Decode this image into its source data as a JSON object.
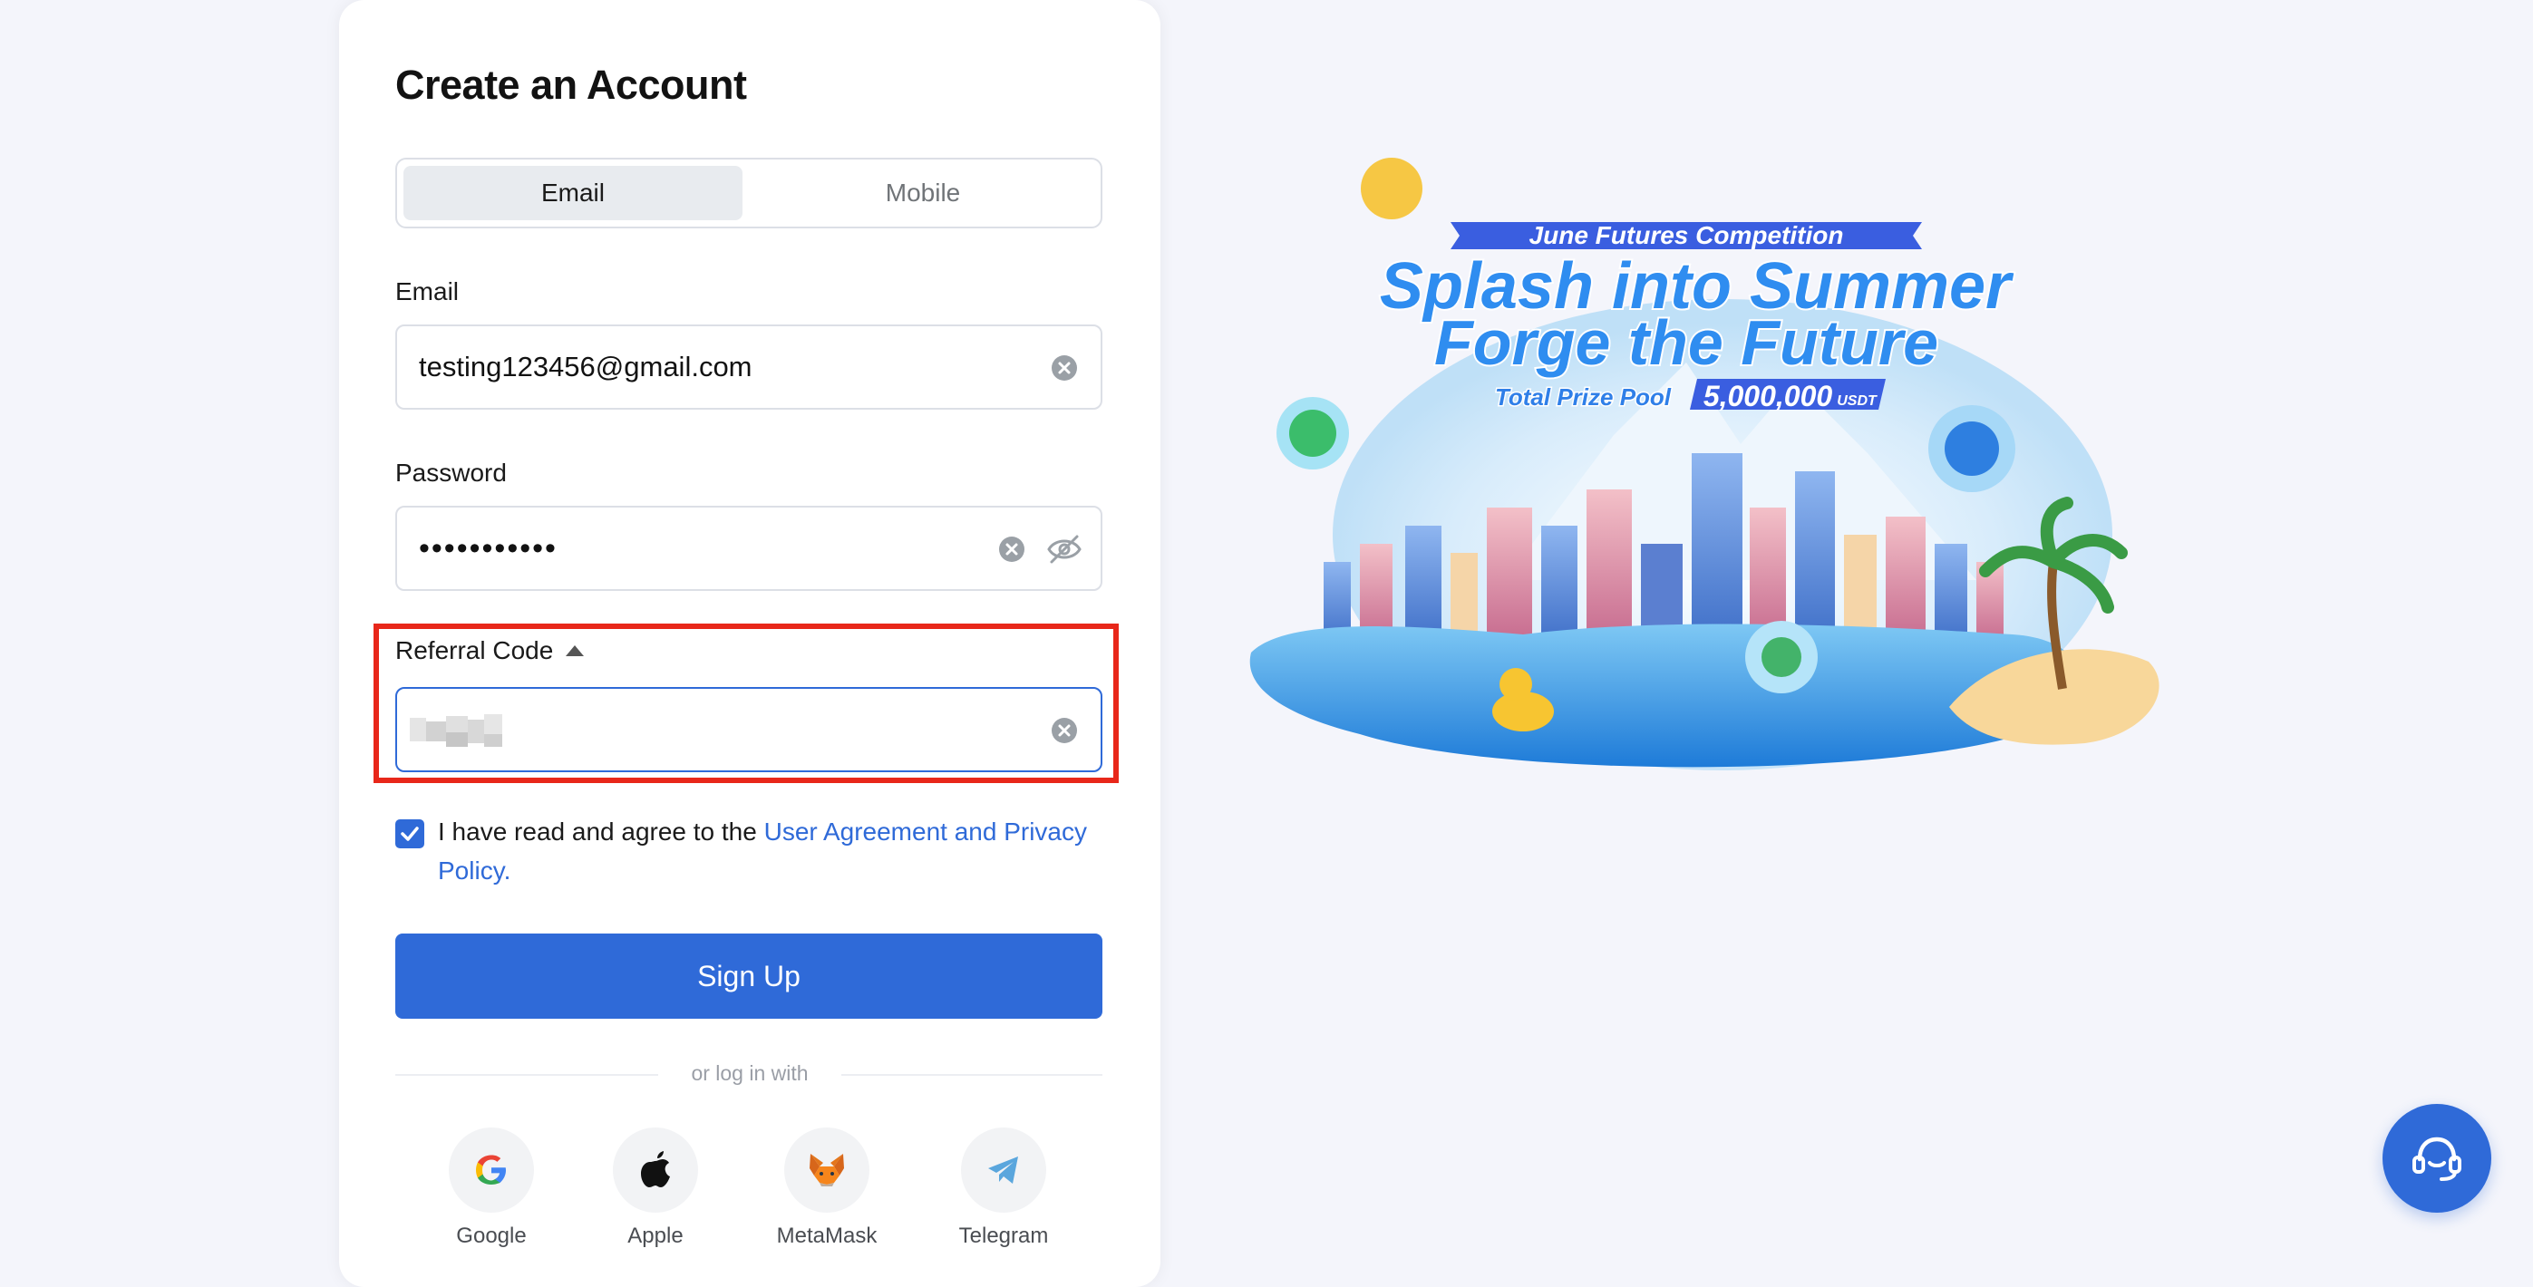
{
  "form": {
    "title": "Create an Account",
    "tabs": [
      {
        "label": "Email",
        "active": true
      },
      {
        "label": "Mobile",
        "active": false
      }
    ],
    "email": {
      "label": "Email",
      "value": "testing123456@gmail.com"
    },
    "password": {
      "label": "Password",
      "value": "•••••••••••"
    },
    "referral": {
      "label": "Referral Code",
      "value": ""
    },
    "agreement": {
      "checked": true,
      "text": "I have read and agree to the ",
      "link": "User Agreement and Privacy Policy",
      "suffix": "."
    },
    "signup_label": "Sign Up",
    "divider_text": "or log in with",
    "social": [
      {
        "label": "Google",
        "icon": "google-icon"
      },
      {
        "label": "Apple",
        "icon": "apple-icon"
      },
      {
        "label": "MetaMask",
        "icon": "metamask-icon"
      },
      {
        "label": "Telegram",
        "icon": "telegram-icon"
      }
    ]
  },
  "banner": {
    "ribbon": "June Futures Competition",
    "headline_1": "Splash into Summer",
    "headline_2": "Forge the Future",
    "prize_label": "Total Prize Pool",
    "prize_amount": "5,000,000",
    "prize_unit": "USDT"
  },
  "support": {
    "icon": "customer-support-icon"
  },
  "colors": {
    "accent": "#2f6ad8",
    "highlight": "#e8271a",
    "page_bg": "#f4f5fb"
  }
}
